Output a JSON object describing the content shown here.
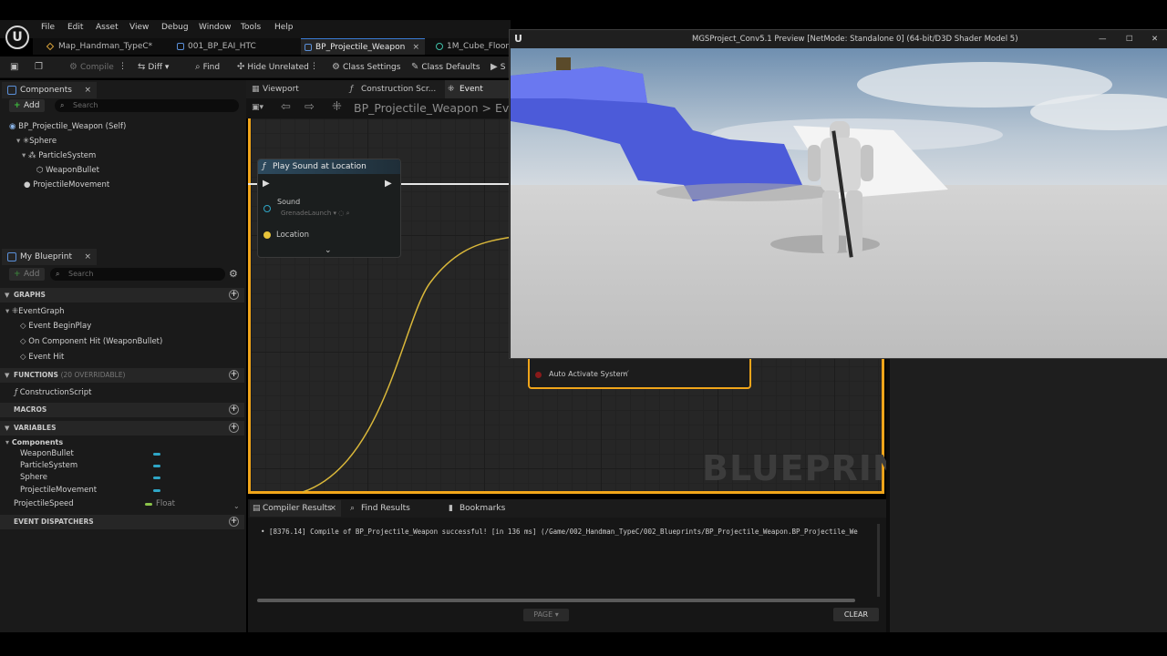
{
  "menu": [
    "File",
    "Edit",
    "Asset",
    "View",
    "Debug",
    "Window",
    "Tools",
    "Help"
  ],
  "doc_tabs": [
    {
      "label": "Map_Handman_TypeC*"
    },
    {
      "label": "001_BP_EAI_HTC"
    },
    {
      "label": "BP_Projectile_Weapon"
    },
    {
      "label": "1M_Cube_Floor"
    }
  ],
  "toolbar": {
    "compile": "Compile",
    "diff": "Diff",
    "find": "Find",
    "hide_unrelated": "Hide Unrelated",
    "class_settings": "Class Settings",
    "class_defaults": "Class Defaults",
    "simulate_fragment": "S"
  },
  "components_panel": {
    "title": "Components",
    "add": "Add",
    "search_placeholder": "Search",
    "tree": [
      "BP_Projectile_Weapon (Self)",
      "Sphere",
      "ParticleSystem",
      "WeaponBullet",
      "ProjectileMovement"
    ]
  },
  "my_blueprint": {
    "title": "My Blueprint",
    "add": "Add",
    "search_placeholder": "Search",
    "graphs_header": "GRAPHS",
    "event_graph": "EventGraph",
    "events": [
      "Event BeginPlay",
      "On Component Hit (WeaponBullet)",
      "Event Hit"
    ],
    "functions_header": "FUNCTIONS",
    "functions_note": "(20 OVERRIDABLE)",
    "construction_script": "ConstructionScript",
    "macros_header": "MACROS",
    "variables_header": "VARIABLES",
    "components_group": "Components",
    "variables": [
      "WeaponBullet",
      "ParticleSystem",
      "Sphere",
      "ProjectileMovement"
    ],
    "projectile_speed": "ProjectileSpeed",
    "projectile_speed_type": "Float",
    "event_dispatchers_header": "EVENT DISPATCHERS"
  },
  "graph_tabs": [
    "Viewport",
    "Construction Scr...",
    "Event Graph"
  ],
  "breadcrumb": {
    "blueprint": "BP_Projectile_Weapon",
    "graph": "Even"
  },
  "node_play_sound": {
    "title": "Play Sound at Location",
    "sound_label": "Sound",
    "sound_value": "GrenadeLaunch",
    "location_label": "Location"
  },
  "node_spawn": {
    "auto_activate": "Auto Activate System"
  },
  "graph_watermark": "BLUEPRINT",
  "bottom_tabs": [
    "Compiler Results",
    "Find Results",
    "Bookmarks"
  ],
  "compile_log": "[8376.14] Compile of BP_Projectile_Weapon successful! [in 136 ms] (/Game/002_Handman_TypeC/002_Blueprints/BP_Projectile_Weapon.BP_Projectile_We",
  "page_button": "PAGE",
  "clear_button": "CLEAR",
  "preview_window": {
    "title": "MGSProject_Conv5.1 Preview [NetMode: Standalone 0]  (64-bit/D3D Shader Model 5)",
    "minimize": "—",
    "maximize": "☐",
    "close": "✕"
  },
  "colors": {
    "accent": "#f0a51a",
    "active_tab": "#3a7bd5",
    "add_green": "#3fbf3f",
    "var_pill": "#2fa6c6",
    "float_pill": "#8bc34a"
  }
}
